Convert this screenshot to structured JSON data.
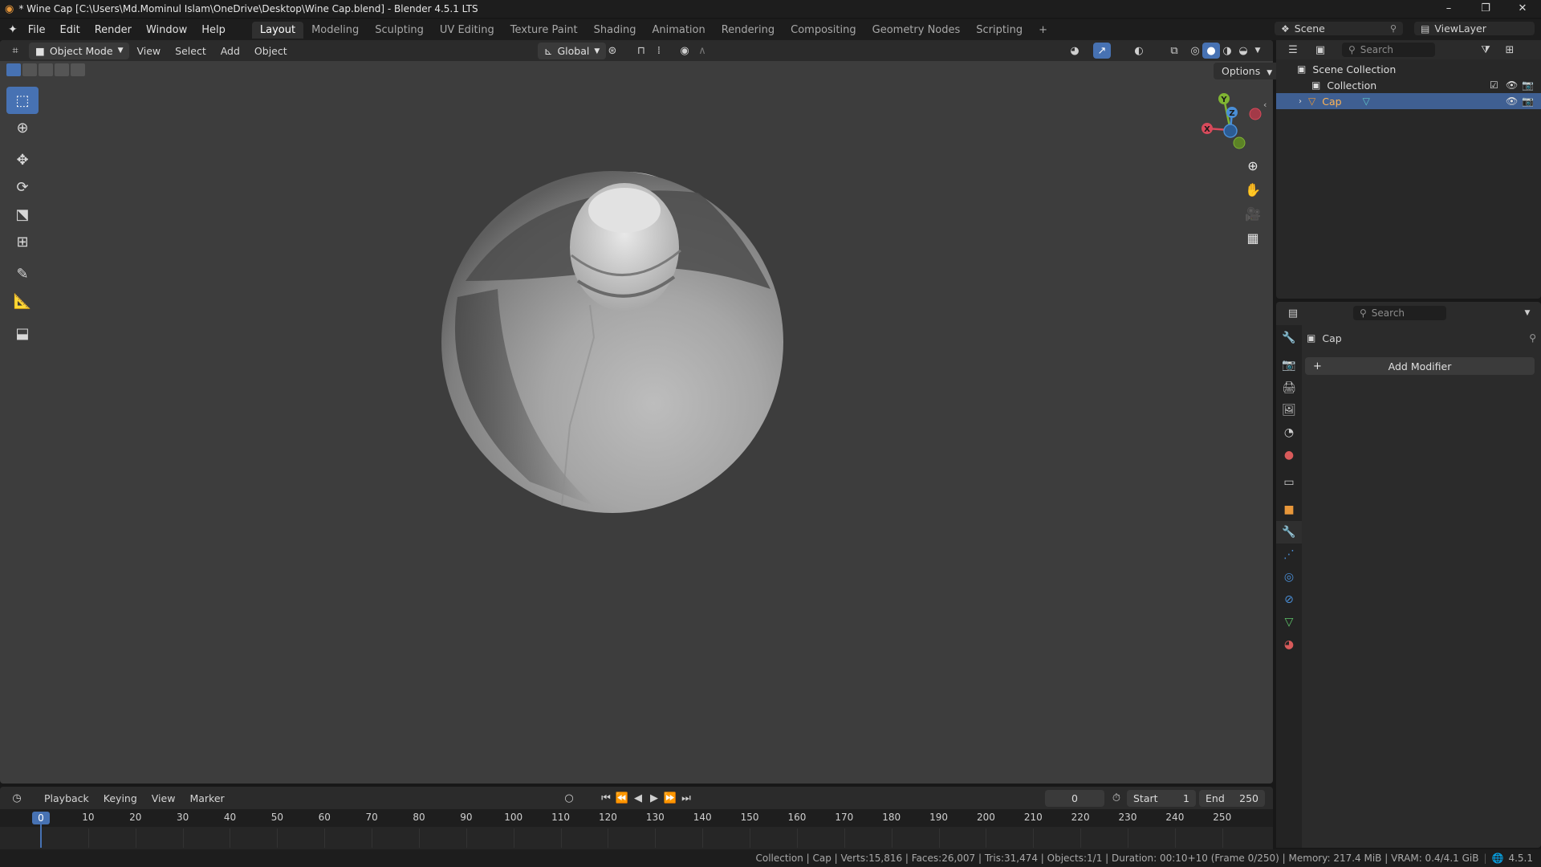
{
  "window": {
    "title": "* Wine Cap [C:\\Users\\Md.Mominul Islam\\OneDrive\\Desktop\\Wine Cap.blend] - Blender 4.5.1 LTS",
    "controls": [
      "–",
      "❐",
      "✕"
    ]
  },
  "menubar": {
    "items": [
      "File",
      "Edit",
      "Render",
      "Window",
      "Help"
    ],
    "workspaces": [
      "Layout",
      "Modeling",
      "Sculpting",
      "UV Editing",
      "Texture Paint",
      "Shading",
      "Animation",
      "Rendering",
      "Compositing",
      "Geometry Nodes",
      "Scripting"
    ],
    "active_workspace": "Layout",
    "add_workspace": "+",
    "scene_label": "Scene",
    "viewlayer_label": "ViewLayer"
  },
  "viewport_header": {
    "mode": "Object Mode",
    "menus": [
      "View",
      "Select",
      "Add",
      "Object"
    ],
    "orientation": "Global",
    "options_label": "Options"
  },
  "viewport": {
    "axes": {
      "x": "X",
      "y": "Y",
      "z": "Z"
    },
    "axis_colors": {
      "x": "#d84a5b",
      "y": "#7fb432",
      "z": "#4a8fd8"
    }
  },
  "timeline": {
    "menus": [
      "Playback",
      "Keying",
      "View",
      "Marker"
    ],
    "current_frame": "0",
    "start_label": "Start",
    "start_value": "1",
    "end_label": "End",
    "end_value": "250",
    "ticks": [
      "10",
      "20",
      "30",
      "40",
      "50",
      "60",
      "70",
      "80",
      "90",
      "100",
      "110",
      "120",
      "130",
      "140",
      "150",
      "160",
      "170",
      "180",
      "190",
      "200",
      "210",
      "220",
      "230",
      "240",
      "250"
    ],
    "playhead": "0"
  },
  "statusbar": {
    "text": "Collection | Cap | Verts:15,816 | Faces:26,007 | Tris:31,474 | Objects:1/1 | Duration: 00:10+10 (Frame 0/250) | Memory: 217.4 MiB | VRAM: 0.4/4.1 GiB",
    "version": "4.5.1"
  },
  "outliner": {
    "search_placeholder": "Search",
    "rows": [
      {
        "label": "Scene Collection"
      },
      {
        "label": "Collection"
      },
      {
        "label": "Cap"
      }
    ]
  },
  "properties": {
    "search_placeholder": "Search",
    "object_name": "Cap",
    "add_modifier_label": "Add Modifier"
  },
  "colors": {
    "accent": "#4772b3",
    "selection": "#3f5f92",
    "object_orange": "#e8973a"
  }
}
